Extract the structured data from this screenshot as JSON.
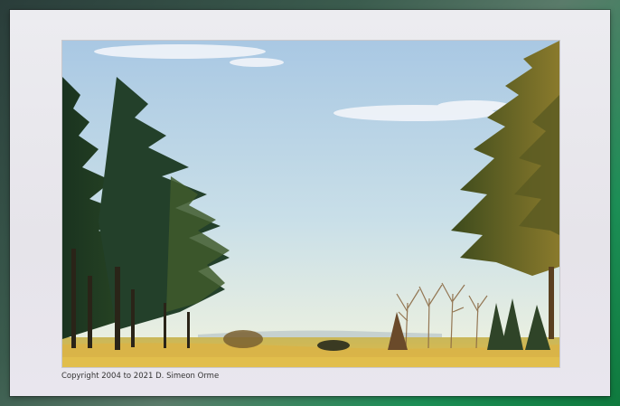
{
  "photo": {
    "subject": "landscape-pine-trees-meadow",
    "colors": {
      "sky_top": "#a8c8e4",
      "sky_bottom": "#eef3e2",
      "pine_dark": "#1c3a1e",
      "pine_light": "#5e6b26",
      "meadow": "#d8b94a"
    }
  },
  "caption": {
    "text": "Copyright 2004 to 2021 D. Simeon Orme"
  }
}
